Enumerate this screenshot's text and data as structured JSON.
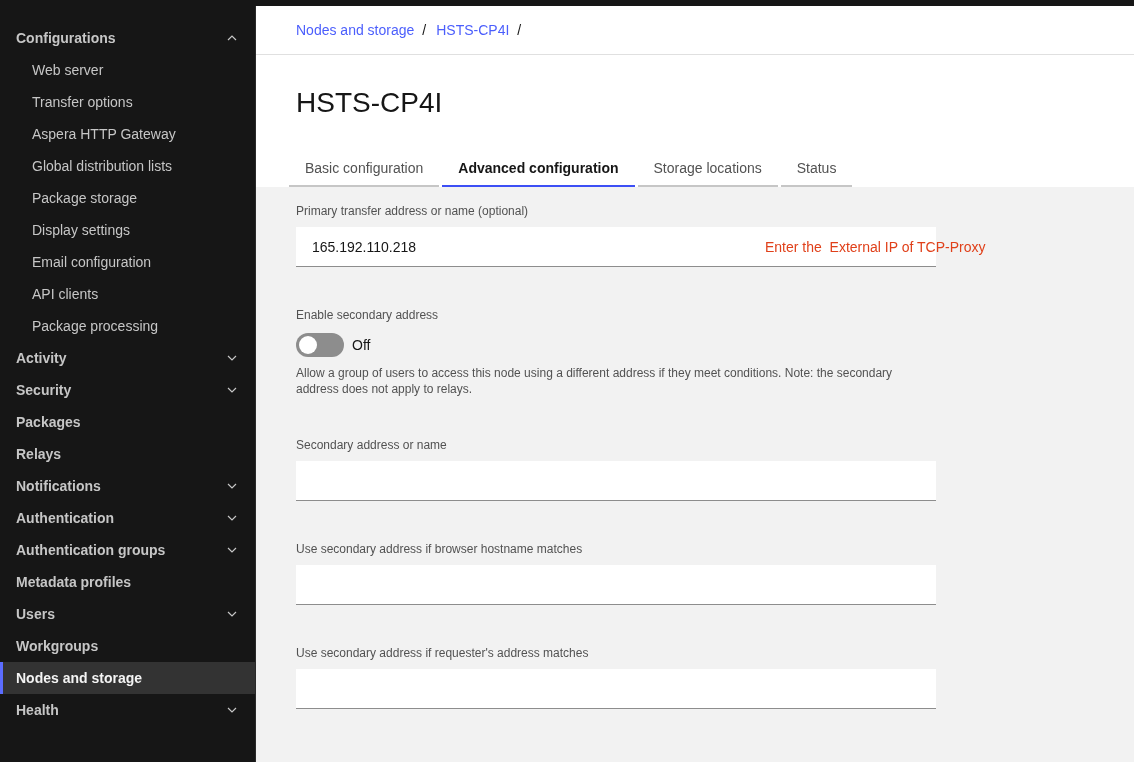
{
  "sidebar": {
    "items": [
      {
        "label": "Configurations",
        "expanded": true,
        "selected": false,
        "children": [
          {
            "label": "Web server",
            "selected": false
          },
          {
            "label": "Transfer options",
            "selected": false
          },
          {
            "label": "Aspera HTTP Gateway",
            "selected": false
          },
          {
            "label": "Global distribution lists",
            "selected": false
          },
          {
            "label": "Package storage",
            "selected": false
          },
          {
            "label": "Display settings",
            "selected": false
          },
          {
            "label": "Email configuration",
            "selected": false
          },
          {
            "label": "API clients",
            "selected": false
          },
          {
            "label": "Package processing",
            "selected": false
          }
        ]
      },
      {
        "label": "Activity",
        "expanded": false,
        "selected": false
      },
      {
        "label": "Security",
        "expanded": false,
        "selected": false
      },
      {
        "label": "Packages",
        "selected": false
      },
      {
        "label": "Relays",
        "selected": false
      },
      {
        "label": "Notifications",
        "expanded": false,
        "selected": false
      },
      {
        "label": "Authentication",
        "expanded": false,
        "selected": false
      },
      {
        "label": "Authentication groups",
        "expanded": false,
        "selected": false
      },
      {
        "label": "Metadata profiles",
        "selected": false
      },
      {
        "label": "Users",
        "expanded": false,
        "selected": false
      },
      {
        "label": "Workgroups",
        "selected": false
      },
      {
        "label": "Nodes and storage",
        "selected": true
      },
      {
        "label": "Health",
        "expanded": false,
        "selected": false
      }
    ]
  },
  "breadcrumb": [
    {
      "label": "Nodes and storage",
      "separator": "/"
    },
    {
      "label": "HSTS-CP4I",
      "separator": "/"
    }
  ],
  "page_title": "HSTS-CP4I",
  "tabs": [
    {
      "label": "Basic configuration",
      "selected": false
    },
    {
      "label": "Advanced configuration",
      "selected": true
    },
    {
      "label": "Storage locations",
      "selected": false
    },
    {
      "label": "Status",
      "selected": false
    }
  ],
  "form": [
    {
      "kind": "text",
      "label": "Primary transfer address or name (optional)",
      "value": "165.192.110.218",
      "annotation": "Enter the  External IP of TCP-Proxy"
    },
    {
      "kind": "toggle",
      "label": "Enable secondary address",
      "on": false,
      "state_text": "Off",
      "help": "Allow a group of users to access this node using a different address if they meet conditions. Note: the secondary address does not apply to relays."
    },
    {
      "kind": "text",
      "label": "Secondary address or name"
    },
    {
      "kind": "text",
      "label": "Use secondary address if browser hostname matches"
    },
    {
      "kind": "text",
      "label": "Use secondary address if requester's address matches"
    }
  ]
}
